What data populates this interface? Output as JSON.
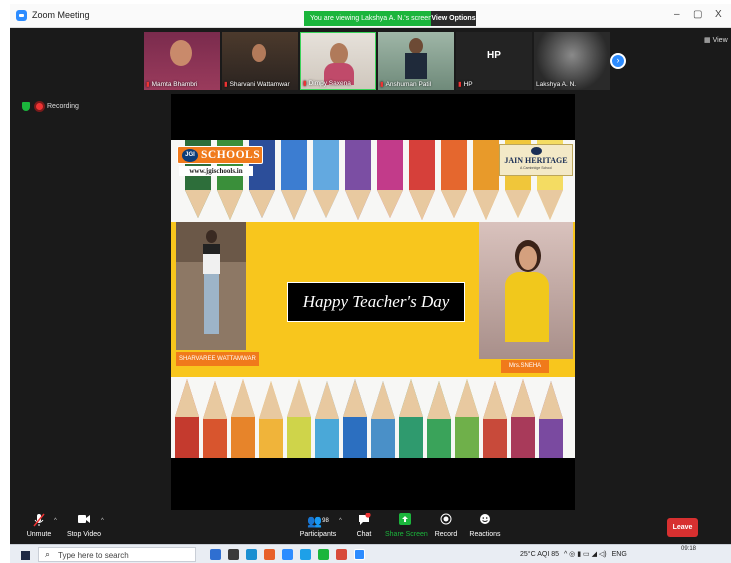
{
  "window": {
    "title": "Zoom Meeting",
    "viewing_banner": "You are viewing Lakshya A. N.'s screen",
    "view_options_label": "View Options",
    "minimize": "–",
    "maximize": "▢",
    "close": "X",
    "view_button": "View"
  },
  "participants": [
    {
      "name": "Mamta Bhambri"
    },
    {
      "name": "Sharvani Wattamwar"
    },
    {
      "name": "Dimpy Saxena"
    },
    {
      "name": "Anshuman Patil"
    },
    {
      "name": "HP",
      "tile_text": "HP"
    },
    {
      "name": "Lakshya A. N."
    }
  ],
  "recording": {
    "label": "Recording"
  },
  "slide": {
    "logo_left": "SCHOOLS",
    "logo_left_badge": "JGI",
    "website": "www.jgischools.in",
    "logo_right": "JAIN HERITAGE",
    "logo_right_sub": "A Cambridge School",
    "headline": "Happy Teacher's Day",
    "student_caption": "SHARVAREE WATTAMWAR",
    "teacher_caption": "Mrs.SNEHA"
  },
  "toolbar": {
    "unmute": "Unmute",
    "stop_video": "Stop Video",
    "participants": "Participants",
    "participants_count": "98",
    "chat": "Chat",
    "share_screen": "Share Screen",
    "record": "Record",
    "reactions": "Reactions",
    "leave": "Leave"
  },
  "taskbar": {
    "search_placeholder": "Type here to search",
    "weather": "25°C AQI 85",
    "lang": "ENG",
    "time": "09:18"
  },
  "colors": {
    "zoom_blue": "#2d8cff",
    "banner_green": "#1bb53c",
    "leave_red": "#d73030",
    "slide_yellow": "#f8c61d",
    "label_orange": "#f07a1b"
  }
}
